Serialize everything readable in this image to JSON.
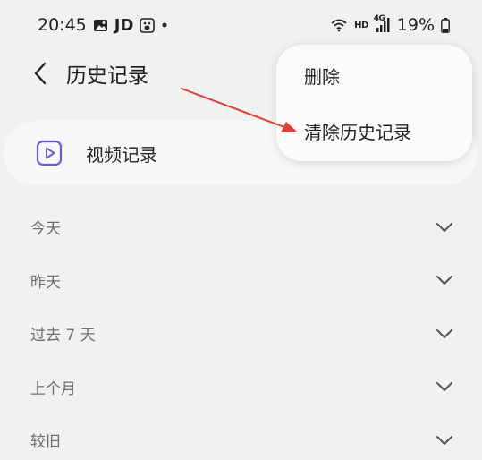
{
  "status_bar": {
    "time": "20:45",
    "left_icons": [
      "gallery-icon",
      "jd-icon",
      "baidu-icon"
    ],
    "jd_text": "JD",
    "hd_text": "HD",
    "network_text": "4G",
    "battery": "19%"
  },
  "header": {
    "title": "历史记录"
  },
  "video_card": {
    "label": "视频记录",
    "icon": "play-square-icon"
  },
  "sections": [
    {
      "label": "今天"
    },
    {
      "label": "昨天"
    },
    {
      "label": "过去 7 天"
    },
    {
      "label": "上个月"
    },
    {
      "label": "较旧"
    }
  ],
  "popup_menu": {
    "items": [
      {
        "label": "删除"
      },
      {
        "label": "清除历史记录"
      }
    ]
  },
  "colors": {
    "background": "#f1f1f1",
    "card": "#f8f8f8",
    "accent_icon": "#6b5bd6",
    "annotation_arrow": "#e53935"
  }
}
